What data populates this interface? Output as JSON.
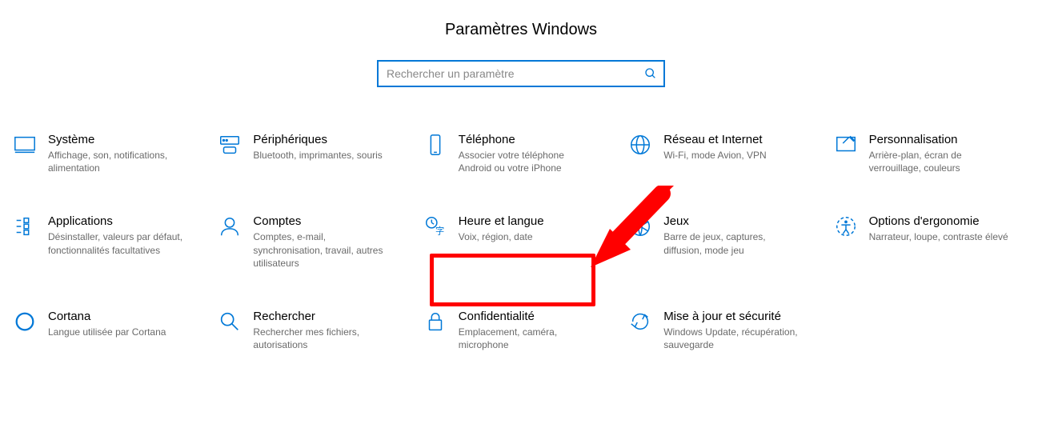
{
  "title": "Paramètres Windows",
  "search": {
    "placeholder": "Rechercher un paramètre",
    "value": ""
  },
  "tiles": {
    "system": {
      "title": "Système",
      "desc": "Affichage, son, notifications, alimentation"
    },
    "devices": {
      "title": "Périphériques",
      "desc": "Bluetooth, imprimantes, souris"
    },
    "phone": {
      "title": "Téléphone",
      "desc": "Associer votre téléphone Android ou votre iPhone"
    },
    "network": {
      "title": "Réseau et Internet",
      "desc": "Wi-Fi, mode Avion, VPN"
    },
    "personal": {
      "title": "Personnalisation",
      "desc": "Arrière-plan, écran de verrouillage, couleurs"
    },
    "apps": {
      "title": "Applications",
      "desc": "Désinstaller, valeurs par défaut, fonctionnalités facultatives"
    },
    "accounts": {
      "title": "Comptes",
      "desc": "Comptes, e-mail, synchronisation, travail, autres utilisateurs"
    },
    "timelang": {
      "title": "Heure et langue",
      "desc": "Voix, région, date"
    },
    "gaming": {
      "title": "Jeux",
      "desc": "Barre de jeux, captures, diffusion, mode jeu"
    },
    "ease": {
      "title": "Options d'ergonomie",
      "desc": "Narrateur, loupe, contraste élevé"
    },
    "cortana": {
      "title": "Cortana",
      "desc": "Langue utilisée par Cortana"
    },
    "search_tile": {
      "title": "Rechercher",
      "desc": "Rechercher mes fichiers, autorisations"
    },
    "privacy": {
      "title": "Confidentialité",
      "desc": "Emplacement, caméra, microphone"
    },
    "update": {
      "title": "Mise à jour et sécurité",
      "desc": "Windows Update, récupération, sauvegarde"
    }
  },
  "annotation": {
    "highlighted_tile": "timelang"
  }
}
